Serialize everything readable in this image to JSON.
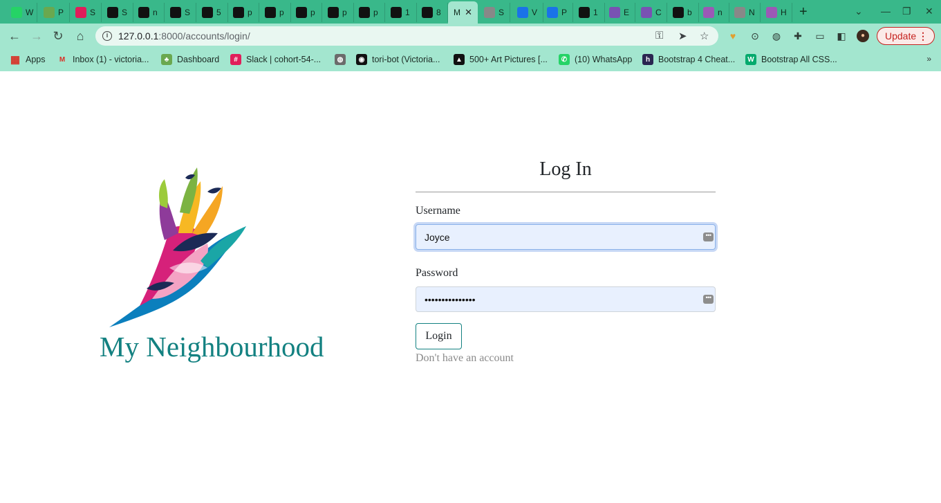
{
  "tabs": [
    {
      "label": "W",
      "icon": "whatsapp-icon",
      "color": "#25d366"
    },
    {
      "label": "P",
      "icon": "tree-icon",
      "color": "#6aa84f"
    },
    {
      "label": "S",
      "icon": "slack-icon",
      "color": "#e01e5a"
    },
    {
      "label": "S",
      "icon": "github-icon",
      "color": "#111111"
    },
    {
      "label": "n",
      "icon": "github-icon",
      "color": "#111111"
    },
    {
      "label": "S",
      "icon": "github-icon",
      "color": "#111111"
    },
    {
      "label": "5",
      "icon": "shop-icon",
      "color": "#111111"
    },
    {
      "label": "p",
      "icon": "github-icon",
      "color": "#111111"
    },
    {
      "label": "p",
      "icon": "github-icon",
      "color": "#111111"
    },
    {
      "label": "p",
      "icon": "github-icon",
      "color": "#111111"
    },
    {
      "label": "p",
      "icon": "github-icon",
      "color": "#111111"
    },
    {
      "label": "p",
      "icon": "github-icon",
      "color": "#111111"
    },
    {
      "label": "1",
      "icon": "is-icon",
      "color": "#111111"
    },
    {
      "label": "8",
      "icon": "is-icon",
      "color": "#111111"
    },
    {
      "label": "M",
      "icon": "",
      "color": "",
      "active": true
    },
    {
      "label": "S",
      "icon": "globe-icon",
      "color": "#888888"
    },
    {
      "label": "V",
      "icon": "c-icon",
      "color": "#1a73e8"
    },
    {
      "label": "P",
      "icon": "c-icon",
      "color": "#1a73e8"
    },
    {
      "label": "1",
      "icon": "shop-icon",
      "color": "#111111"
    },
    {
      "label": "E",
      "icon": "bootstrap-icon",
      "color": "#7952b3"
    },
    {
      "label": "C",
      "icon": "bootstrap-icon",
      "color": "#7952b3"
    },
    {
      "label": "b",
      "icon": "github-icon",
      "color": "#111111"
    },
    {
      "label": "n",
      "icon": "h-icon",
      "color": "#9b59b6"
    },
    {
      "label": "N",
      "icon": "globe-icon",
      "color": "#888888"
    },
    {
      "label": "H",
      "icon": "h-icon",
      "color": "#9b59b6"
    }
  ],
  "toolbar": {
    "url_host": "127.0.0.1",
    "url_rest": ":8000/accounts/login/",
    "update_label": "Update"
  },
  "bookmarks": [
    {
      "label": "Apps",
      "icon": "apps-grid-icon"
    },
    {
      "label": "Inbox (1) - victoria...",
      "icon": "gmail-icon"
    },
    {
      "label": "Dashboard",
      "icon": "tree-icon"
    },
    {
      "label": "Slack | cohort-54-...",
      "icon": "slack-icon"
    },
    {
      "label": "",
      "icon": "globe-icon"
    },
    {
      "label": "tori-bot (Victoria...",
      "icon": "github-icon"
    },
    {
      "label": "500+ Art Pictures [...",
      "icon": "shop-icon"
    },
    {
      "label": "(10) WhatsApp",
      "icon": "whatsapp-icon"
    },
    {
      "label": "Bootstrap 4 Cheat...",
      "icon": "hackerthemes-icon"
    },
    {
      "label": "Bootstrap All CSS...",
      "icon": "w3-icon"
    }
  ],
  "page": {
    "brand": "My Neighbourhood",
    "login_title": "Log In",
    "username_label": "Username",
    "username_value": "Joyce",
    "password_label": "Password",
    "password_value": "•••••••••••••••",
    "login_button": "Login",
    "signup_link": "Don't have an account"
  },
  "colors": {
    "tabstrip": "#39b88a",
    "toolbar": "#a3e6cf",
    "brand": "#138181",
    "input_bg": "#e8f0fe"
  }
}
